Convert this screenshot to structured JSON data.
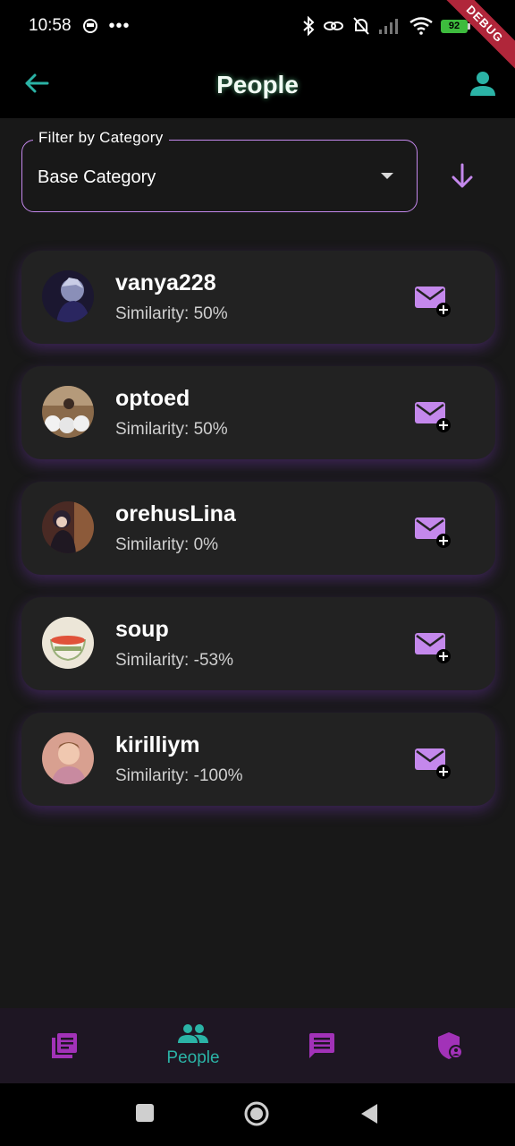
{
  "status_bar": {
    "time": "10:58",
    "battery": "92",
    "debug_label": "DEBUG"
  },
  "app_bar": {
    "title": "People",
    "accent_color": "#2bb3a6"
  },
  "filter": {
    "label": "Filter by Category",
    "value": "Base Category",
    "border_color": "#c488ec"
  },
  "people": [
    {
      "name": "vanya228",
      "similarity": "Similarity: 50%"
    },
    {
      "name": "optoed",
      "similarity": "Similarity: 50%"
    },
    {
      "name": "orehusLina",
      "similarity": "Similarity: 0%"
    },
    {
      "name": "soup",
      "similarity": "Similarity: -53%"
    },
    {
      "name": "kirilliym",
      "similarity": "Similarity: -100%"
    }
  ],
  "bottom_nav": {
    "items": [
      {
        "icon": "library-icon",
        "label": ""
      },
      {
        "icon": "people-icon",
        "label": "People",
        "active": true
      },
      {
        "icon": "chat-icon",
        "label": ""
      },
      {
        "icon": "admin-shield-icon",
        "label": ""
      }
    ],
    "active_color": "#2bb3a6",
    "inactive_color": "#a232b8"
  }
}
